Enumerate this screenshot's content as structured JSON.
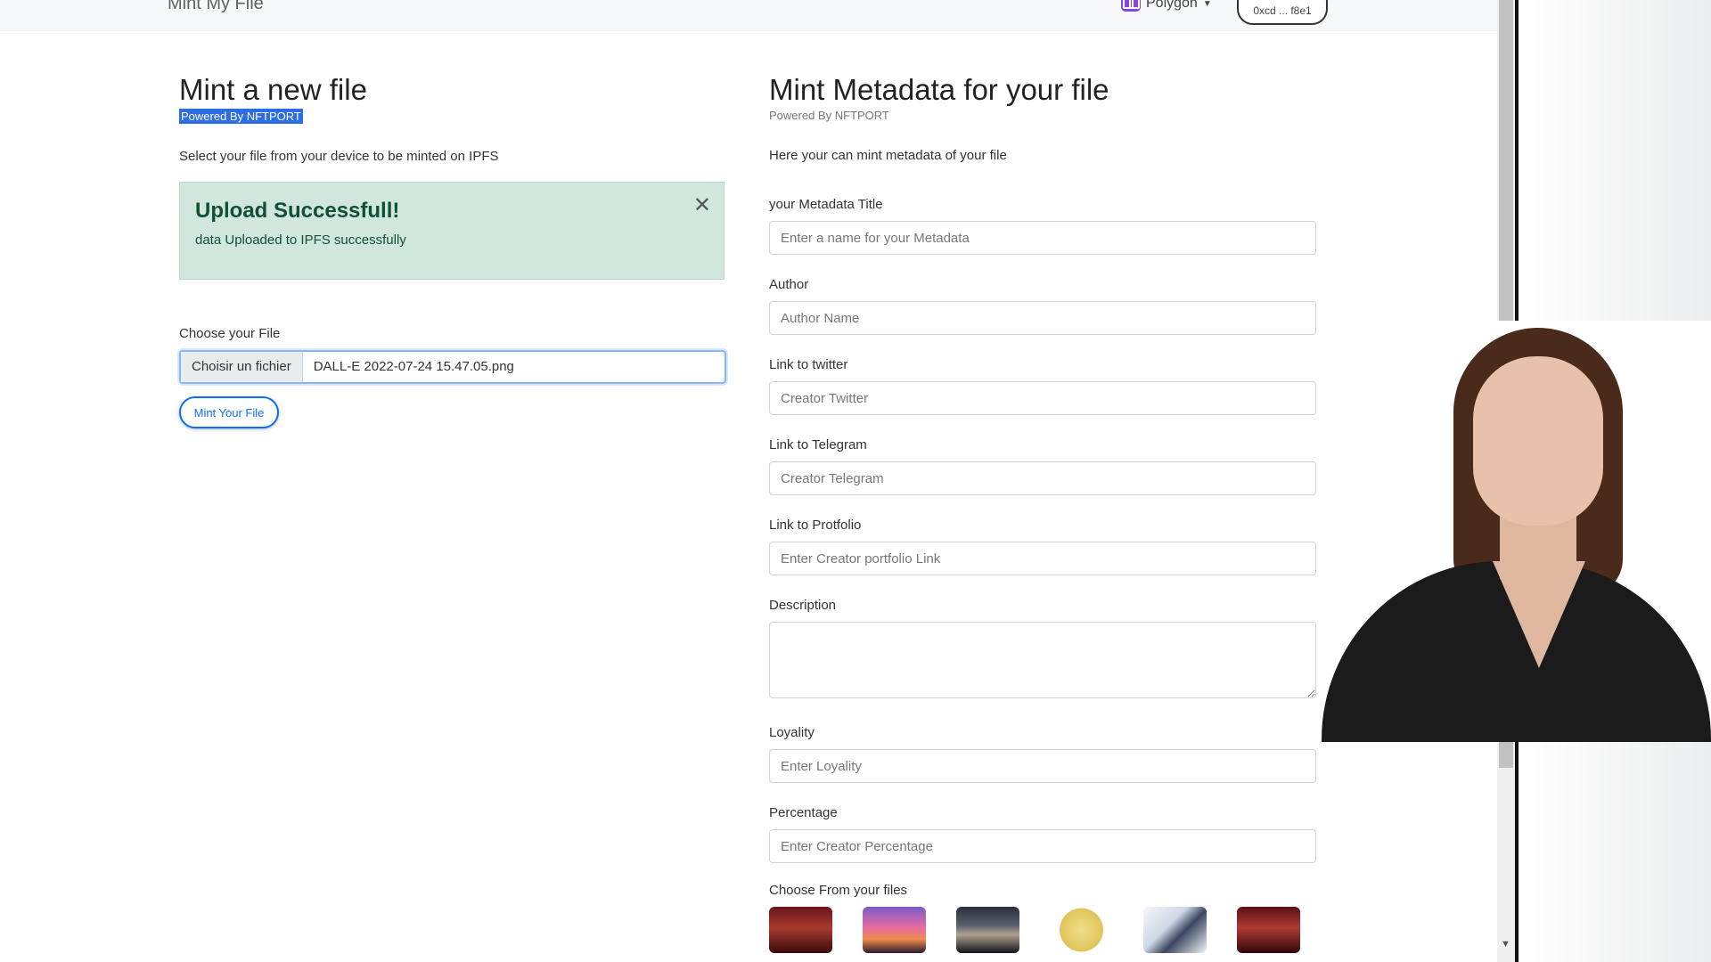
{
  "navbar": {
    "brand": "Mint My File",
    "network_label": "Polygon",
    "wallet_label": "0xcd ... f8e1"
  },
  "mint_file": {
    "title": "Mint a new file",
    "powered_by": "Powered By NFTPORT",
    "intro": "Select your file from your device to be minted on IPFS",
    "alert": {
      "title": "Upload Successfull!",
      "body": "data Uploaded to IPFS successfully"
    },
    "file_label": "Choose your File",
    "file_button": "Choisir un fichier",
    "file_name": "DALL-E 2022-07-24 15.47.05.png",
    "mint_button": "Mint Your File"
  },
  "metadata": {
    "title": "Mint Metadata for your file",
    "powered_by": "Powered By NFTPORT",
    "intro": "Here your can mint metadata of your file",
    "fields": {
      "title": {
        "label": "your Metadata Title",
        "placeholder": "Enter a name for your Metadata"
      },
      "author": {
        "label": "Author",
        "placeholder": "Author Name"
      },
      "twitter": {
        "label": "Link to twitter",
        "placeholder": "Creator Twitter"
      },
      "telegram": {
        "label": "Link to Telegram",
        "placeholder": "Creator Telegram"
      },
      "portfolio": {
        "label": "Link to Protfolio",
        "placeholder": "Enter Creator portfolio Link"
      },
      "description": {
        "label": "Description",
        "placeholder": ""
      },
      "loyality": {
        "label": "Loyality",
        "placeholder": "Enter Loyality"
      },
      "percentage": {
        "label": "Percentage",
        "placeholder": "Enter Creator Percentage"
      }
    },
    "files_label": "Choose From your files"
  },
  "icons": {
    "close": "close-icon",
    "network": "polygon-logo-icon",
    "caret": "chevron-down-icon"
  }
}
